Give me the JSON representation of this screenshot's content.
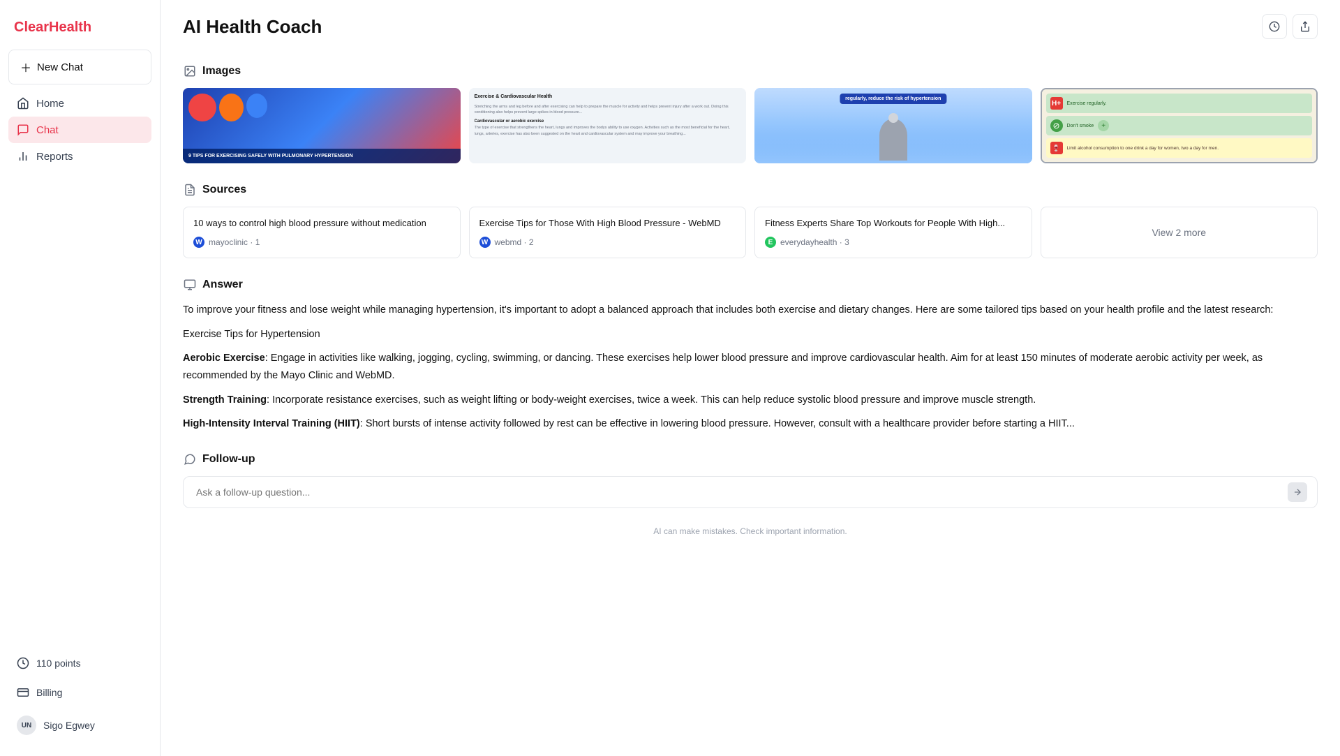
{
  "app": {
    "name": "ClearHealth"
  },
  "sidebar": {
    "new_chat_label": "New Chat",
    "nav_items": [
      {
        "id": "home",
        "label": "Home",
        "icon": "home-icon",
        "active": false
      },
      {
        "id": "chat",
        "label": "Chat",
        "icon": "chat-icon",
        "active": true
      },
      {
        "id": "reports",
        "label": "Reports",
        "icon": "reports-icon",
        "active": false
      }
    ],
    "bottom_items": [
      {
        "id": "points",
        "label": "110 points",
        "icon": "points-icon"
      },
      {
        "id": "billing",
        "label": "Billing",
        "icon": "billing-icon"
      }
    ],
    "user": {
      "initials": "UN",
      "name": "Sigo Egwey"
    }
  },
  "header": {
    "title": "AI Health Coach",
    "history_button_label": "History",
    "share_button_label": "Share"
  },
  "images_section": {
    "heading": "Images",
    "images": [
      {
        "id": "img1",
        "alt": "9 tips for exercising safely with pulmonary hypertension"
      },
      {
        "id": "img2",
        "alt": "Exercise stretching article"
      },
      {
        "id": "img3",
        "alt": "Person exercising with weights"
      },
      {
        "id": "img4",
        "alt": "Tips infographic: exercise regularly, don't smoke, limit alcohol"
      }
    ]
  },
  "sources_section": {
    "heading": "Sources",
    "sources": [
      {
        "id": "src1",
        "title": "10 ways to control high blood pressure without medication",
        "site": "mayoclinic",
        "site_label": "mayoclinic",
        "number": "1",
        "favicon_letter": "W",
        "favicon_class": "mayo"
      },
      {
        "id": "src2",
        "title": "Exercise Tips for Those With High Blood Pressure - WebMD",
        "site": "webmd",
        "site_label": "webmd",
        "number": "2",
        "favicon_letter": "W",
        "favicon_class": "webmd"
      },
      {
        "id": "src3",
        "title": "Fitness Experts Share Top Workouts for People With High...",
        "site": "everydayhealth",
        "site_label": "everydayhealth",
        "number": "3",
        "favicon_letter": "E",
        "favicon_class": "everyday"
      }
    ],
    "view_more_label": "View 2 more"
  },
  "answer_section": {
    "heading": "Answer",
    "intro": "To improve your fitness and lose weight while managing hypertension, it's important to adopt a balanced approach that includes both exercise and dietary changes. Here are some tailored tips based on your health profile and the latest research:",
    "subtitle": "Exercise Tips for Hypertension",
    "tips": [
      {
        "bold": "Aerobic Exercise",
        "text": ": Engage in activities like walking, jogging, cycling, swimming, or dancing. These exercises help lower blood pressure and improve cardiovascular health. Aim for at least 150 minutes of moderate aerobic activity per week, as recommended by the Mayo Clinic and WebMD."
      },
      {
        "bold": "Strength Training",
        "text": ": Incorporate resistance exercises, such as weight lifting or body-weight exercises, twice a week. This can help reduce systolic blood pressure and improve muscle strength."
      },
      {
        "bold": "High-Intensity Interval Training (HIIT)",
        "text": ": Short bursts of intense activity followed by rest can be effective in lowering blood pressure. However, consult with a healthcare provider before starting a HIIT..."
      }
    ]
  },
  "followup_section": {
    "heading": "Follow-up",
    "placeholder": "Ask a follow-up question..."
  },
  "disclaimer": "AI can make mistakes. Check important information."
}
